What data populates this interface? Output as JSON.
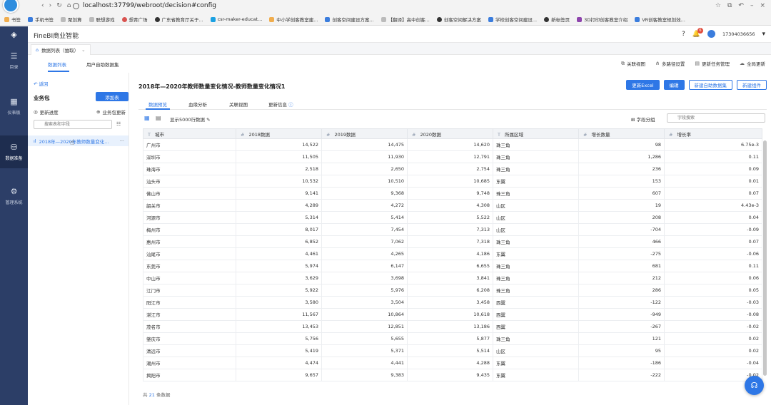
{
  "browser": {
    "address": "localhost:37799/webroot/decision#config",
    "bookmarks": [
      "书签",
      "手机书签",
      "聚划算",
      "联想游戏",
      "想青广场",
      "广东省教育厅关于...",
      "csr-maker-educat...",
      "中小学创客教室建...",
      "创客空间建设方案...",
      "【翻译】高中创客...",
      "创客空间解决方案",
      "学校创客空间建设...",
      "新标签页",
      "3D打印创客教室介绍",
      "VR创客教室规划效..."
    ]
  },
  "app": {
    "title": "FineBI商业智能",
    "user": "17304036656",
    "notifications": "6"
  },
  "left_nav": [
    {
      "label": "目录",
      "icon": "menu-icon"
    },
    {
      "label": "仪表板",
      "icon": "dashboard-icon"
    },
    {
      "label": "数据准备",
      "icon": "database-icon"
    },
    {
      "label": "管理系统",
      "icon": "gear-icon"
    }
  ],
  "tab_strip": {
    "active_tab": "数据列表（抽取）"
  },
  "sub_header": {
    "tabs": [
      "数据列表",
      "用户自助数据集"
    ],
    "actions": [
      "关联视图",
      "多路径设置",
      "更新任务管理",
      "全局更新"
    ]
  },
  "sidebar": {
    "back": "返回",
    "package_label": "业务包",
    "add_table": "添加表",
    "update_progress": "更新进度",
    "package_update": "业务包更新",
    "search_placeholder": "搜索表和字段",
    "tree_item": "2018年—2020年教师数量变化..."
  },
  "main": {
    "title": "2018年—2020年教师数量变化情况-教师数量变化情况1",
    "buttons": [
      "更新Excel",
      "编辑",
      "新建自助数据集",
      "新建组件"
    ],
    "view_tabs": [
      "数据预览",
      "血缘分析",
      "关联视图",
      "更新信息"
    ],
    "row_display": "显示5000行数据",
    "field_group": "字段分组",
    "field_search_placeholder": "字段搜索",
    "row_count_prefix": "共",
    "row_count_value": "21",
    "row_count_suffix": "条数据"
  },
  "table": {
    "columns": [
      {
        "type": "T",
        "name": "城市"
      },
      {
        "type": "#",
        "name": "2018数据"
      },
      {
        "type": "#",
        "name": "2019数据"
      },
      {
        "type": "#",
        "name": "2020数据"
      },
      {
        "type": "T",
        "name": "所属区域"
      },
      {
        "type": "#",
        "name": "增长数量"
      },
      {
        "type": "#",
        "name": "增长率"
      }
    ],
    "rows": [
      [
        "广州市",
        "14,522",
        "14,475",
        "14,620",
        "珠三角",
        "98",
        "6.75e-3"
      ],
      [
        "深圳市",
        "11,505",
        "11,930",
        "12,791",
        "珠三角",
        "1,286",
        "0.11"
      ],
      [
        "珠海市",
        "2,518",
        "2,650",
        "2,754",
        "珠三角",
        "236",
        "0.09"
      ],
      [
        "汕头市",
        "10,532",
        "10,510",
        "10,685",
        "东翼",
        "153",
        "0.01"
      ],
      [
        "佛山市",
        "9,141",
        "9,368",
        "9,748",
        "珠三角",
        "607",
        "0.07"
      ],
      [
        "韶关市",
        "4,289",
        "4,272",
        "4,308",
        "山区",
        "19",
        "4.43e-3"
      ],
      [
        "河源市",
        "5,314",
        "5,414",
        "5,522",
        "山区",
        "208",
        "0.04"
      ],
      [
        "梅州市",
        "8,017",
        "7,454",
        "7,313",
        "山区",
        "-704",
        "-0.09"
      ],
      [
        "惠州市",
        "6,852",
        "7,062",
        "7,318",
        "珠三角",
        "466",
        "0.07"
      ],
      [
        "汕尾市",
        "4,461",
        "4,265",
        "4,186",
        "东翼",
        "-275",
        "-0.06"
      ],
      [
        "东莞市",
        "5,974",
        "6,147",
        "6,655",
        "珠三角",
        "681",
        "0.11"
      ],
      [
        "中山市",
        "3,629",
        "3,698",
        "3,841",
        "珠三角",
        "212",
        "0.06"
      ],
      [
        "江门市",
        "5,922",
        "5,976",
        "6,208",
        "珠三角",
        "286",
        "0.05"
      ],
      [
        "阳江市",
        "3,580",
        "3,504",
        "3,458",
        "西翼",
        "-122",
        "-0.03"
      ],
      [
        "湛江市",
        "11,567",
        "10,864",
        "10,618",
        "西翼",
        "-949",
        "-0.08"
      ],
      [
        "茂名市",
        "13,453",
        "12,851",
        "13,186",
        "西翼",
        "-267",
        "-0.02"
      ],
      [
        "肇庆市",
        "5,756",
        "5,655",
        "5,877",
        "珠三角",
        "121",
        "0.02"
      ],
      [
        "清远市",
        "5,419",
        "5,371",
        "5,514",
        "山区",
        "95",
        "0.02"
      ],
      [
        "潮州市",
        "4,474",
        "4,441",
        "4,288",
        "东翼",
        "-186",
        "-0.04"
      ],
      [
        "揭阳市",
        "9,657",
        "9,383",
        "9,435",
        "东翼",
        "-222",
        "-0.02"
      ]
    ]
  }
}
